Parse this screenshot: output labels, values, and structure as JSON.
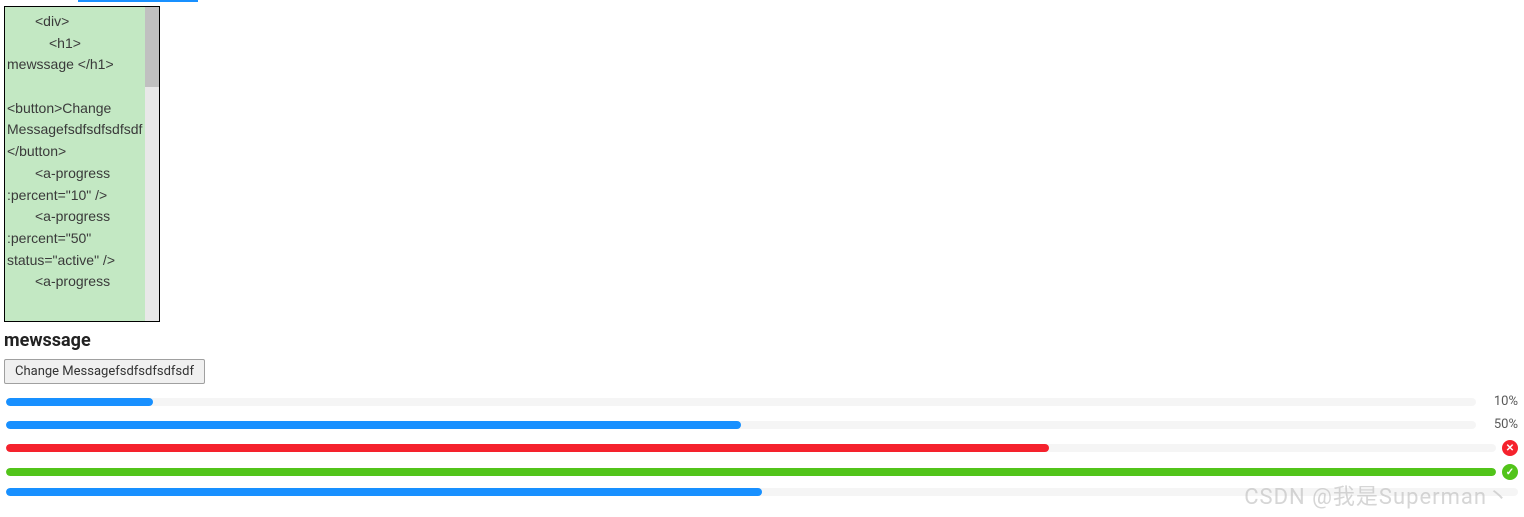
{
  "code_panel": {
    "lines": [
      {
        "text": "<div>",
        "cls": "indent1"
      },
      {
        "text": "<h1>",
        "cls": "indent2"
      },
      {
        "text": "mewssage </h1>",
        "cls": ""
      },
      {
        "text": " ",
        "cls": ""
      },
      {
        "text": "<button>Change Messagefsdfsdfsdfsdf</button>",
        "cls": ""
      },
      {
        "text": "<a-progress :percent=\"10\" />",
        "cls": "indent0b"
      },
      {
        "text": "<a-progress :percent=\"50\" status=\"active\" />",
        "cls": "indent0b"
      },
      {
        "text": "<a-progress",
        "cls": "indent0b"
      }
    ]
  },
  "heading": "mewssage",
  "button_label": "Change Messagefsdfsdfsdfsdf",
  "progress": [
    {
      "percent": 10,
      "color": "blue",
      "label": "10%",
      "show_label": true,
      "icon": null
    },
    {
      "percent": 50,
      "color": "blue",
      "label": "50%",
      "show_label": true,
      "icon": null
    },
    {
      "percent": 70,
      "color": "red",
      "label": "",
      "show_label": false,
      "icon": "error"
    },
    {
      "percent": 100,
      "color": "green",
      "label": "",
      "show_label": false,
      "icon": "success"
    },
    {
      "percent": 50,
      "color": "blue",
      "label": "",
      "show_label": false,
      "icon": null
    }
  ],
  "icons": {
    "error_glyph": "✕",
    "success_glyph": "✓"
  },
  "watermark": "CSDN @我是Superman丶"
}
